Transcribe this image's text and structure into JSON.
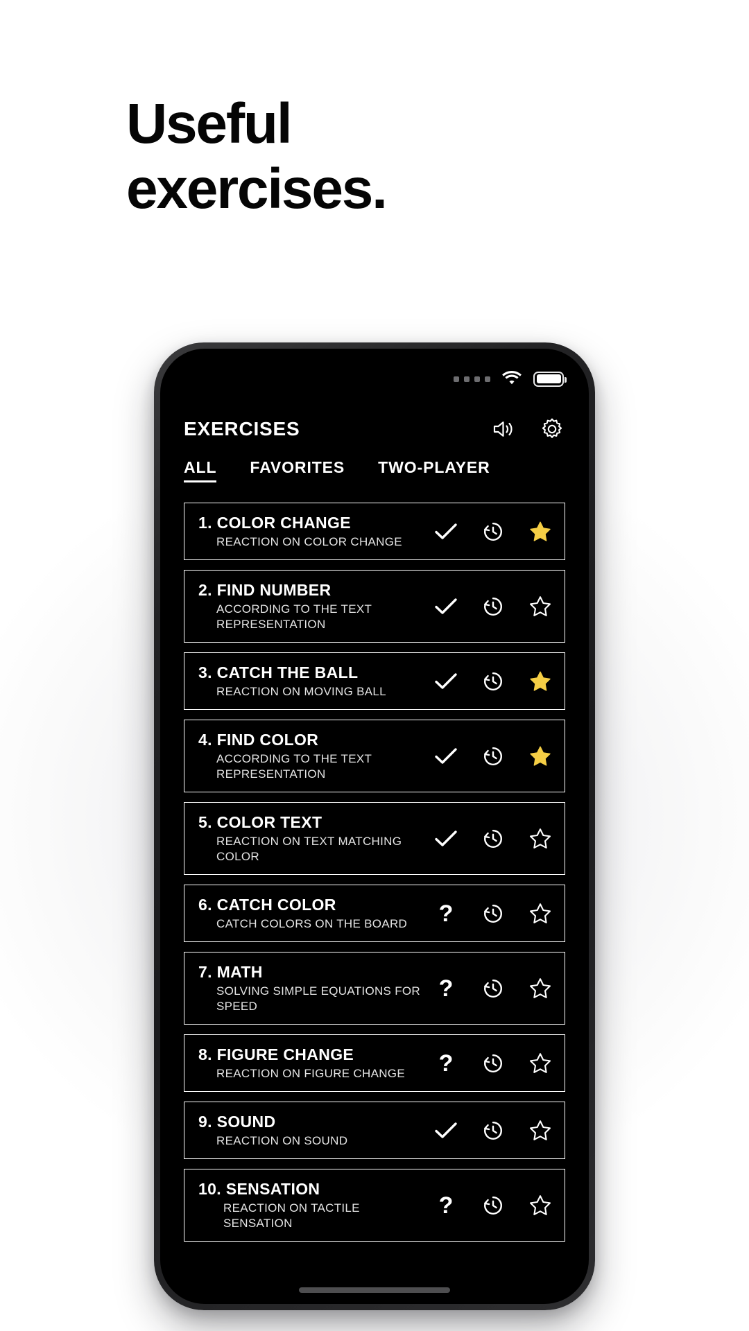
{
  "headline": {
    "line1": "Useful",
    "line2": "exercises."
  },
  "phone": {
    "status_bar": {
      "signal_icon": "signal-dots-icon",
      "signal_dots": 4,
      "wifi_icon": "wifi-icon",
      "battery_icon": "battery-full-icon",
      "battery_level": "100"
    },
    "header": {
      "title": "EXERCISES",
      "sound_icon": "speaker-volume-icon",
      "settings_icon": "gear-icon"
    },
    "tabs": [
      {
        "label": "ALL",
        "active": true
      },
      {
        "label": "FAVORITES",
        "active": false
      },
      {
        "label": "TWO-PLAYER",
        "active": false
      }
    ],
    "icons": {
      "check": "check-icon",
      "question": "question-mark-icon",
      "history": "history-clock-icon",
      "star_filled": "star-filled-icon",
      "star_outline": "star-outline-icon"
    },
    "colors": {
      "star_gold": "#F5CE45",
      "screen_bg": "#000000",
      "text": "#FFFFFF"
    },
    "exercises": [
      {
        "number": "1.",
        "name": "COLOR CHANGE",
        "title": "1. COLOR CHANGE",
        "subtitle": "REACTION ON COLOR CHANGE",
        "status": "check",
        "favorite": true
      },
      {
        "number": "2.",
        "name": "FIND NUMBER",
        "title": "2. FIND NUMBER",
        "subtitle": "ACCORDING TO THE TEXT REPRESENTATION",
        "status": "check",
        "favorite": false
      },
      {
        "number": "3.",
        "name": "CATCH THE BALL",
        "title": "3. CATCH THE BALL",
        "subtitle": "REACTION ON MOVING BALL",
        "status": "check",
        "favorite": true
      },
      {
        "number": "4.",
        "name": "FIND COLOR",
        "title": "4. FIND COLOR",
        "subtitle": "ACCORDING TO THE TEXT REPRESENTATION",
        "status": "check",
        "favorite": true
      },
      {
        "number": "5.",
        "name": "COLOR TEXT",
        "title": "5. COLOR TEXT",
        "subtitle": "REACTION ON TEXT MATCHING COLOR",
        "status": "check",
        "favorite": false
      },
      {
        "number": "6.",
        "name": "CATCH COLOR",
        "title": "6. CATCH COLOR",
        "subtitle": "CATCH COLORS ON THE BOARD",
        "status": "question",
        "favorite": false
      },
      {
        "number": "7.",
        "name": "MATH",
        "title": "7. MATH",
        "subtitle": "SOLVING SIMPLE EQUATIONS FOR SPEED",
        "status": "question",
        "favorite": false
      },
      {
        "number": "8.",
        "name": "FIGURE CHANGE",
        "title": "8. FIGURE CHANGE",
        "subtitle": "REACTION ON FIGURE CHANGE",
        "status": "question",
        "favorite": false
      },
      {
        "number": "9.",
        "name": "SOUND",
        "title": "9. SOUND",
        "subtitle": "REACTION ON SOUND",
        "status": "check",
        "favorite": false
      },
      {
        "number": "10.",
        "name": "SENSATION",
        "title": "10. SENSATION",
        "subtitle": "REACTION ON TACTILE SENSATION",
        "status": "question",
        "favorite": false
      }
    ],
    "home_indicator": "home-indicator"
  }
}
